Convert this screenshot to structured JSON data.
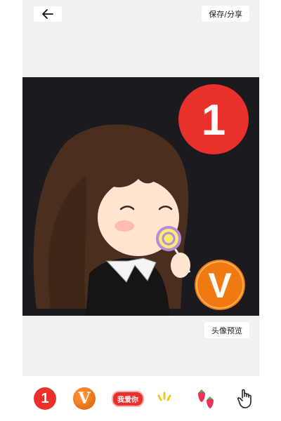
{
  "toolbar": {
    "back_icon": "arrow-left-icon",
    "save_share_label": "保存/分享"
  },
  "canvas": {
    "badge_number_text": "1",
    "badge_letter_text": "V",
    "colors": {
      "background": "#1b1b1f",
      "badge_red": "#e9302b",
      "badge_orange": "#f07a12"
    }
  },
  "preview": {
    "label": "头像预览"
  },
  "stickers": {
    "items": [
      {
        "name": "number-1",
        "text": "1"
      },
      {
        "name": "letter-v",
        "text": "V"
      },
      {
        "name": "love-you",
        "text": "我爱你"
      },
      {
        "name": "sparkle",
        "icon": "sparkle-icon"
      },
      {
        "name": "strawberry",
        "icon": "strawberry-icon"
      },
      {
        "name": "hand-pointer",
        "icon": "hand-pointer-icon"
      }
    ]
  }
}
